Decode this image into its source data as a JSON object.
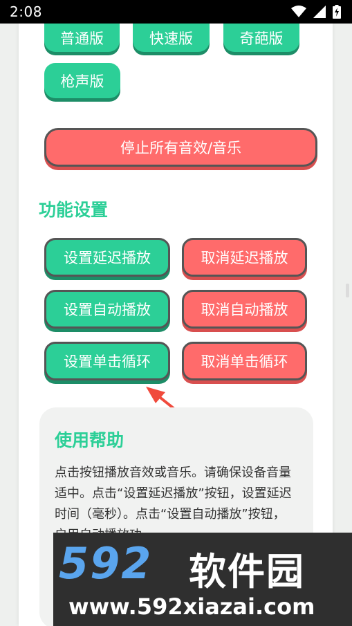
{
  "status_bar": {
    "time": "2:08",
    "icons": [
      "wifi-icon",
      "signal-icon",
      "battery-charging-icon"
    ]
  },
  "sound_buttons": [
    {
      "label": "普通版"
    },
    {
      "label": "快速版"
    },
    {
      "label": "奇葩版"
    },
    {
      "label": "枪声版"
    }
  ],
  "stop_button": {
    "label": "停止所有音效/音乐"
  },
  "settings": {
    "title": "功能设置",
    "set_delay": "设置延迟播放",
    "cancel_delay": "取消延迟播放",
    "set_auto": "设置自动播放",
    "cancel_auto": "取消自动播放",
    "set_loop": "设置单击循环",
    "cancel_loop": "取消单击循环"
  },
  "help": {
    "title": "使用帮助",
    "text": "点击按钮播放音效或音乐。请确保设备音量适中。点击“设置延迟播放”按钮，设置延迟时间（毫秒）。点击“设置自动播放”按钮，启用自动播放功"
  },
  "watermark": {
    "logo": "592",
    "name": "软件园",
    "url": "www.592xiazai.com"
  },
  "colors": {
    "green": "#2ccf97",
    "red": "#ff6b6b",
    "arrow": "#f04a3c"
  }
}
